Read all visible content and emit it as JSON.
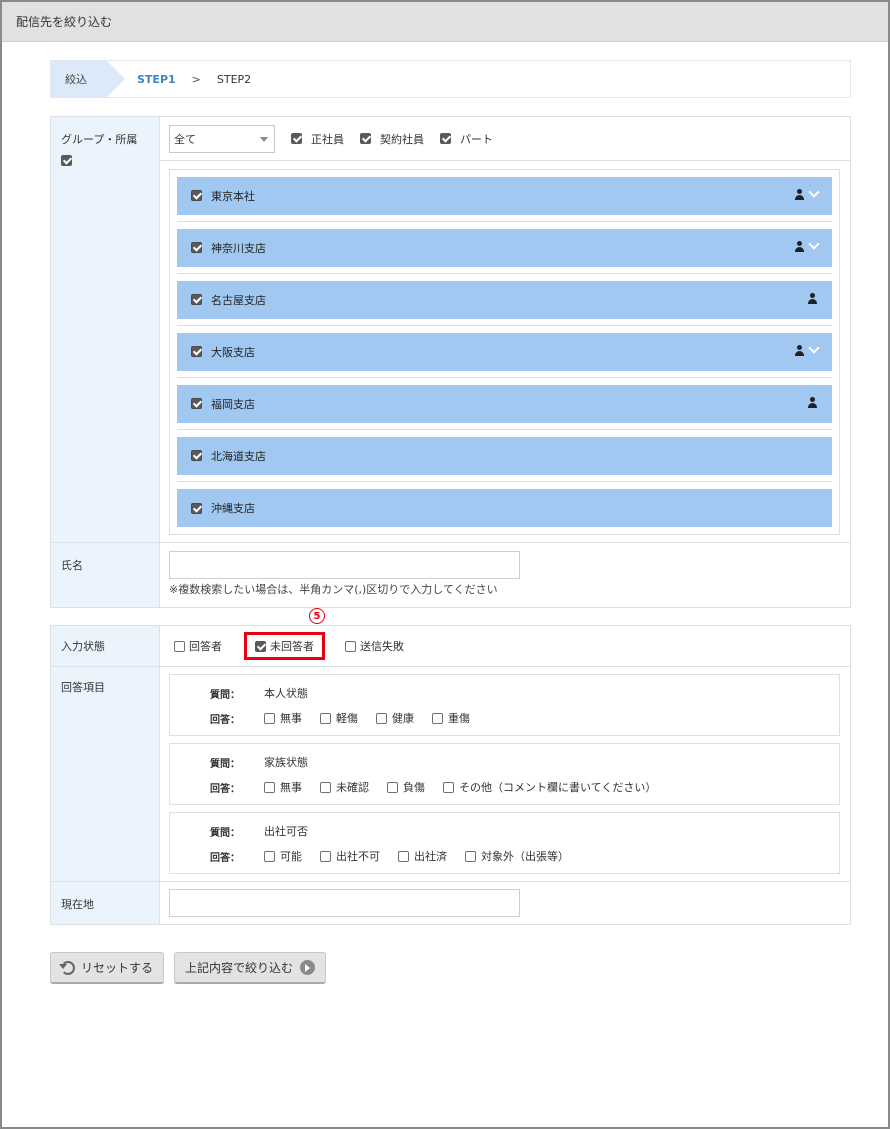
{
  "window": {
    "title": "配信先を絞り込む"
  },
  "breadcrumb": {
    "first": "絞込",
    "step1": "STEP1",
    "separator": ">",
    "step2": "STEP2"
  },
  "group": {
    "label": "グループ・所属",
    "label_checked": true,
    "select_value": "全て",
    "employment_types": [
      {
        "label": "正社員",
        "checked": true
      },
      {
        "label": "契約社員",
        "checked": true
      },
      {
        "label": "パート",
        "checked": true
      }
    ],
    "items": [
      {
        "label": "東京本社",
        "checked": true,
        "has_person_icon": true,
        "has_chevron": true
      },
      {
        "label": "神奈川支店",
        "checked": true,
        "has_person_icon": true,
        "has_chevron": true
      },
      {
        "label": "名古屋支店",
        "checked": true,
        "has_person_icon": true,
        "has_chevron": false
      },
      {
        "label": "大阪支店",
        "checked": true,
        "has_person_icon": true,
        "has_chevron": true
      },
      {
        "label": "福岡支店",
        "checked": true,
        "has_person_icon": true,
        "has_chevron": false
      },
      {
        "label": "北海道支店",
        "checked": true,
        "has_person_icon": false,
        "has_chevron": false
      },
      {
        "label": "沖縄支店",
        "checked": true,
        "has_person_icon": false,
        "has_chevron": false
      }
    ]
  },
  "name": {
    "label": "氏名",
    "value": "",
    "note": "※複数検索したい場合は、半角カンマ(,)区切りで入力してください"
  },
  "status": {
    "label": "入力状態",
    "marker": "5",
    "options": [
      {
        "label": "回答者",
        "checked": false
      },
      {
        "label": "未回答者",
        "checked": true
      },
      {
        "label": "送信失敗",
        "checked": false
      }
    ]
  },
  "answers": {
    "label": "回答項目",
    "question_label": "質問：",
    "answer_label": "回答：",
    "questions": [
      {
        "question": "本人状態",
        "options": [
          "無事",
          "軽傷",
          "健康",
          "重傷"
        ]
      },
      {
        "question": "家族状態",
        "options": [
          "無事",
          "未確認",
          "負傷",
          "その他（コメント欄に書いてください）"
        ]
      },
      {
        "question": "出社可否",
        "options": [
          "可能",
          "出社不可",
          "出社済",
          "対象外（出張等）"
        ]
      }
    ]
  },
  "location": {
    "label": "現在地",
    "value": ""
  },
  "buttons": {
    "reset": "リセットする",
    "submit": "上記内容で絞り込む"
  },
  "colors": {
    "group_bar": "#a0c8f1",
    "header_cell": "#ebf4fd",
    "highlight": "#e60012",
    "step_active": "#3d86c6"
  }
}
